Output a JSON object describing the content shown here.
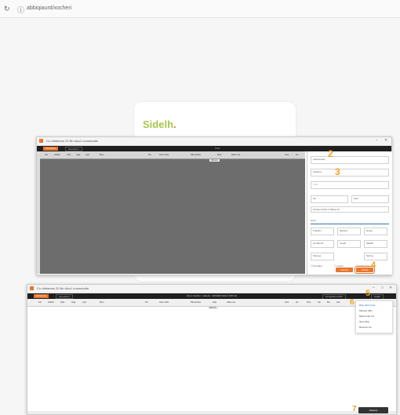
{
  "browser": {
    "url": "abbiqiaurd/xocheri",
    "icons": [
      "reload-icon",
      "site-info-icon"
    ]
  },
  "page": {
    "logo_text": "Sidelh",
    "logo_dot": "."
  },
  "window1": {
    "title": "Co ubilwmos 20 Bn iduc1 nuomaudie",
    "toolbar": {
      "left_buttons": [
        "Orirumna",
        "Acrodenrn"
      ],
      "center_label": "Pollo"
    },
    "columns": [
      "AC",
      "Ahhbi",
      "Ahe",
      "Aga",
      "Apc",
      "Ron",
      "Pa",
      "Aod nicle",
      "Mioundes",
      "Hite",
      "Allos ine",
      "Ans",
      "Ac"
    ],
    "subheader": "Mitbeho",
    "panel": {
      "fields": [
        {
          "label": "",
          "value": "Aubrienaca"
        },
        {
          "label": "",
          "value": "Aubierre"
        },
        {
          "label": "",
          "value": "Phau"
        },
        {
          "label": "",
          "value": "Tio"
        },
        {
          "label": "",
          "value": "Ahcr"
        },
        {
          "label": "",
          "value": "Fincano Pollo 1 PMo2 10"
        }
      ],
      "section": "Hlcre",
      "options": [
        {
          "label": "Trancbn",
          "value": "Moviarc"
        },
        {
          "label": "Hoing",
          "value": ""
        },
        {
          "label": "Coroberto",
          "value": "Coreh"
        },
        {
          "label": "Siladlo",
          "value": ""
        },
        {
          "label": "Shonue",
          "value": ""
        },
        {
          "label": "Surma",
          "value": ""
        }
      ],
      "checkboxes": [
        "Foncline",
        "Coreh",
        "Clarostop"
      ],
      "cancel_label": "Cancel",
      "create_label": "Cresat"
    },
    "steps": [
      "2",
      "3",
      "4"
    ]
  },
  "window2": {
    "title": "Co ubilwmos 20 Bn iduc1 nuomaudie",
    "toolbar": {
      "left_buttons": [
        "Orirumna",
        "Acrodenrn"
      ],
      "center_label": "Monc biudbs 1 10aulle: CWHMICNOE F10B LIE",
      "right_buttons": [
        "Compubrou Mot",
        "Caatn"
      ]
    },
    "columns": [
      "AC",
      "Ahhbi",
      "Ahe",
      "Aga",
      "Apc",
      "Ron",
      "Pa",
      "Aod nicle",
      "Mioundes",
      "Hite",
      "Allos ine",
      "Ans",
      "Ac",
      "Nce",
      "Ap",
      "Ro",
      "Aol"
    ],
    "subheader": "Mitbeho",
    "menu_items": [
      "Rien deho hare",
      "Meaure Alfer",
      "Macoomllc Ioc",
      "Ikee Hlice",
      "Reonciu Ioc"
    ],
    "steps": [
      "5",
      "6",
      "7"
    ],
    "footer_button": "Ahlaoss"
  },
  "colors": {
    "accent": "#e8762d",
    "toolbar": "#1f1f1f",
    "grid_bg": "#6d6d6d",
    "step_marker": "#f0a020",
    "logo": "#a8c64b"
  }
}
